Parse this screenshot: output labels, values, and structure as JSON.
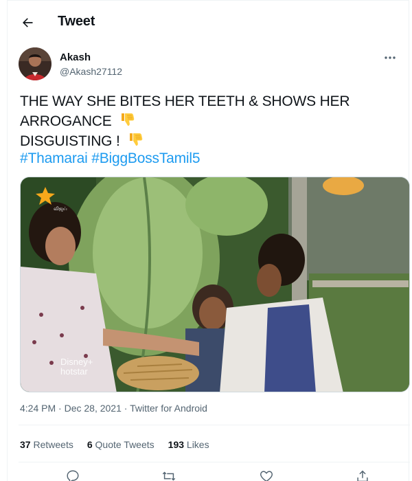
{
  "header": {
    "title": "Tweet"
  },
  "author": {
    "name": "Akash",
    "handle": "@Akash27112"
  },
  "tweet": {
    "line1": "THE WAY SHE BITES HER TEETH & SHOWS HER",
    "line2": "ARROGANCE",
    "line3": "DISGUISTING !",
    "hashtag1": "#Thamarai",
    "hashtag2": "#BiggBossTamil5"
  },
  "media": {
    "watermark": "Disney+ hotstar"
  },
  "meta": {
    "time": "4:24 PM",
    "date": "Dec 28, 2021",
    "separator": "·",
    "source": "Twitter for Android"
  },
  "stats": [
    {
      "count": "37",
      "label": "Retweets"
    },
    {
      "count": "6",
      "label": "Quote Tweets"
    },
    {
      "count": "193",
      "label": "Likes"
    }
  ],
  "colors": {
    "link": "#1d9bf0",
    "muted": "#536471",
    "text": "#0f1419"
  },
  "icons": {
    "back": "arrow-left-icon",
    "more": "more-horizontal-icon",
    "emoji": "thumbs-down-emoji",
    "reply": "reply-icon",
    "retweet": "retweet-icon",
    "like": "heart-icon",
    "share": "share-icon"
  }
}
